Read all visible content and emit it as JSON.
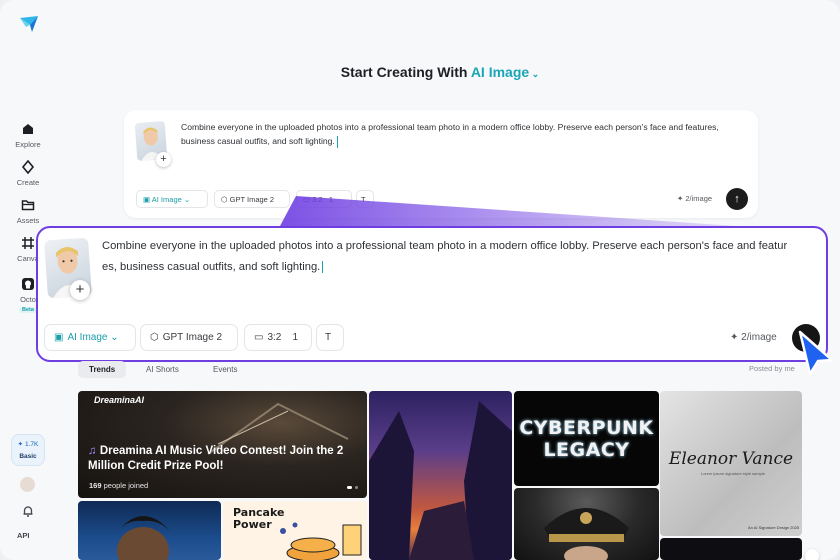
{
  "colors": {
    "accent": "#1aa6b7",
    "highlight_border": "#6e3ee2",
    "dark": "#151515"
  },
  "sidebar": {
    "items": [
      {
        "label": "Explore",
        "icon": "home-icon"
      },
      {
        "label": "Create",
        "icon": "diamond-icon"
      },
      {
        "label": "Assets",
        "icon": "folder-icon"
      },
      {
        "label": "Canva",
        "icon": "canvas-icon"
      },
      {
        "label": "Octo",
        "icon": "octo-icon",
        "badge": "Beta"
      }
    ],
    "credits": {
      "count": "1.7K",
      "level": "Basic"
    },
    "api_label": "API"
  },
  "headline": {
    "prefix": "Start Creating With",
    "mode": "AI Image"
  },
  "prompt": {
    "text": "Combine everyone in the uploaded photos into a professional team photo in a modern office lobby. Preserve each person's face and features, business casual outfits, and soft lighting.",
    "text_line1": "Combine everyone in the uploaded photos into a professional team photo in a modern office lobby. Preserve each person's face and featur",
    "text_line2": "es, business casual outfits, and soft lighting.",
    "mode_label": "AI Image",
    "model_label": "GPT Image 2",
    "ratio_label": "3:2",
    "count_label": "1",
    "rate_label": "2/image"
  },
  "tabs": [
    {
      "label": "Trends",
      "active": true
    },
    {
      "label": "AI Shorts",
      "active": false
    },
    {
      "label": "Events",
      "active": false
    }
  ],
  "posted_by": "Posted by me",
  "gallery": {
    "music": {
      "brand": "DreaminaAI",
      "title": "Dreamina AI Music Video Contest! Join the 2 Million Credit Prize Pool!",
      "joined_count": "169",
      "joined_label": "people joined"
    },
    "cyberpunk": {
      "line1": "CYBERPUNK",
      "line2": "LEGACY"
    },
    "eleanor": {
      "name": "Eleanor Vance",
      "subtitle": "Lorem ipsum signature style sample",
      "foot": "An Ai Signature Design 2025"
    },
    "pancake": {
      "line1": "Pancake",
      "line2": "Power"
    }
  }
}
